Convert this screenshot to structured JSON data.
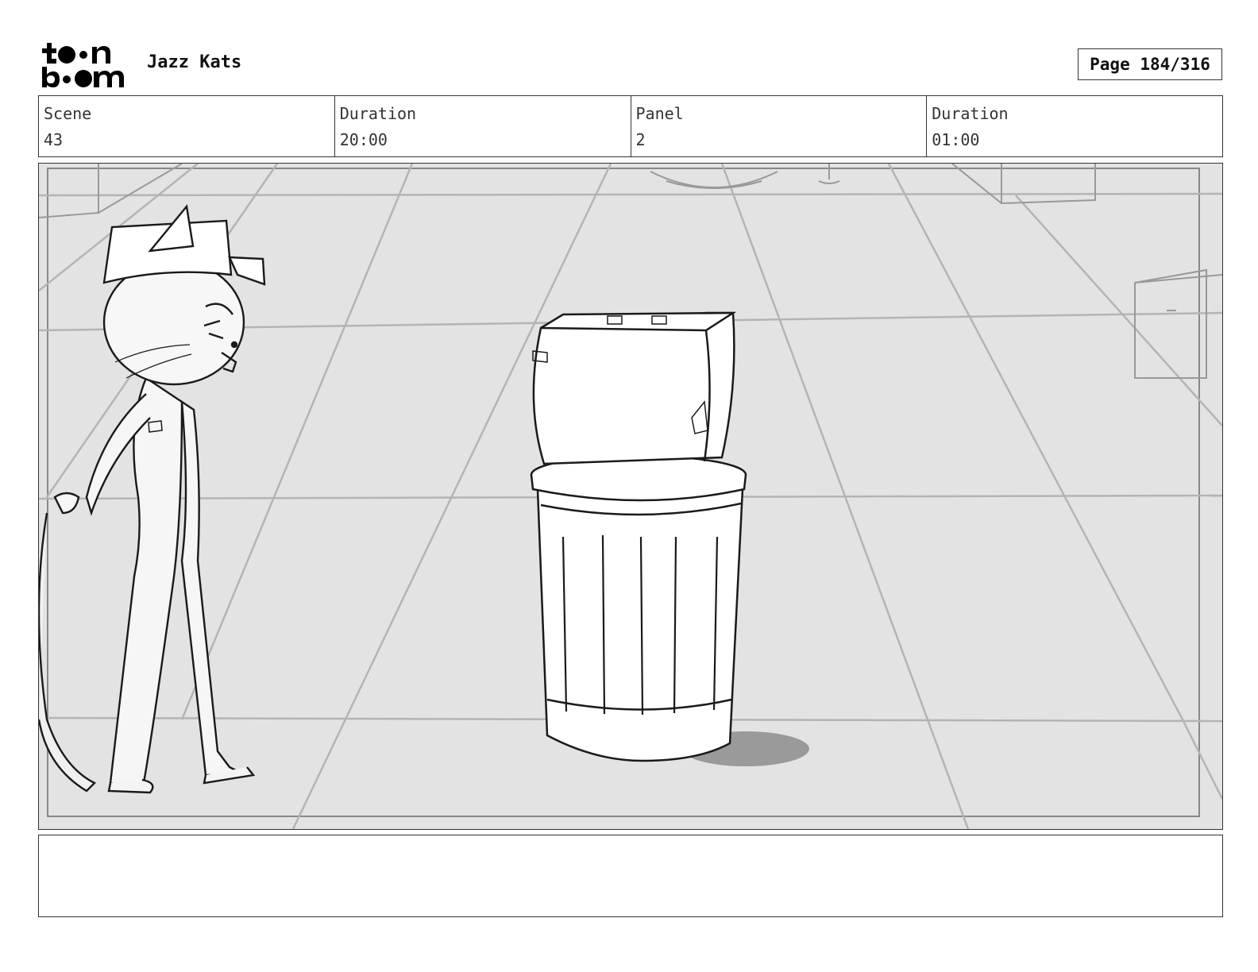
{
  "header": {
    "logo_alt": "toon boom",
    "project_title": "Jazz Kats",
    "page_label": "Page 184/316"
  },
  "info": {
    "scene_label": "Scene",
    "scene_value": "43",
    "scene_duration_label": "Duration",
    "scene_duration_value": "20:00",
    "panel_label": "Panel",
    "panel_value": "2",
    "panel_duration_label": "Duration",
    "panel_duration_value": "01:00"
  },
  "notes": {
    "text": ""
  }
}
